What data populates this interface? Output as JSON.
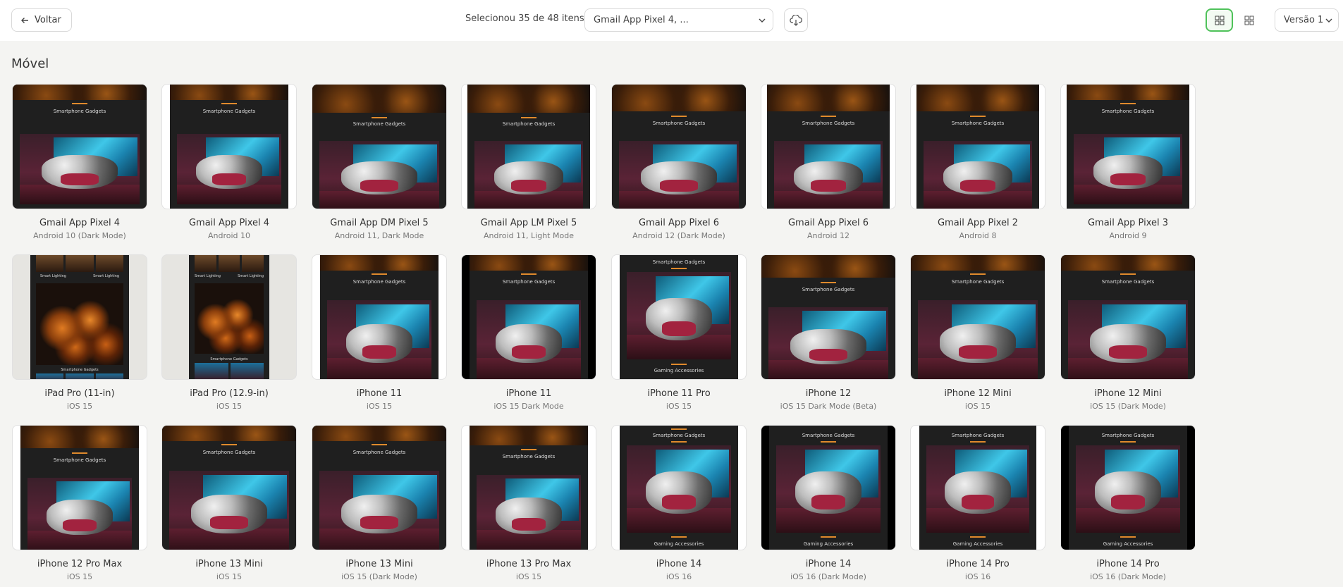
{
  "header": {
    "back_label": "Voltar",
    "selection_text": "Selecionou 35 de 48 itens",
    "device_select_value": "Gmail App Pixel 4, ...",
    "version_label": "Versão 1"
  },
  "colors": {
    "accent": "#4fc25a",
    "orange_accent": "#e08a2c",
    "screen_dark": "#1f1f1f"
  },
  "section": {
    "title": "Móvel"
  },
  "thumb_text": {
    "gadgets": "Smartphone Gadgets",
    "accessories": "Gaming Accessories",
    "lighting_a": "Smart Lighting",
    "lighting_b": "Smart Lighting"
  },
  "devices": [
    {
      "name": "Gmail App Pixel 4",
      "os": "Android 10 (Dark Mode)"
    },
    {
      "name": "Gmail App Pixel 4",
      "os": "Android 10"
    },
    {
      "name": "Gmail App DM Pixel 5",
      "os": "Android 11, Dark Mode"
    },
    {
      "name": "Gmail App LM Pixel 5",
      "os": "Android 11, Light Mode"
    },
    {
      "name": "Gmail App Pixel 6",
      "os": "Android 12 (Dark Mode)"
    },
    {
      "name": "Gmail App Pixel 6",
      "os": "Android 12"
    },
    {
      "name": "Gmail App Pixel 2",
      "os": "Android 8"
    },
    {
      "name": "Gmail App Pixel 3",
      "os": "Android 9"
    },
    {
      "name": "iPad Pro (11-in)",
      "os": "iOS 15"
    },
    {
      "name": "iPad Pro (12.9-in)",
      "os": "iOS 15"
    },
    {
      "name": "iPhone 11",
      "os": "iOS 15"
    },
    {
      "name": "iPhone 11",
      "os": "iOS 15 Dark Mode"
    },
    {
      "name": "iPhone 11 Pro",
      "os": "iOS 15"
    },
    {
      "name": "iPhone 12",
      "os": "iOS 15 Dark Mode (Beta)"
    },
    {
      "name": "iPhone 12 Mini",
      "os": "iOS 15"
    },
    {
      "name": "iPhone 12 Mini",
      "os": "iOS 15 (Dark Mode)"
    },
    {
      "name": "iPhone 12 Pro Max",
      "os": "iOS 15"
    },
    {
      "name": "iPhone 13 Mini",
      "os": "iOS 15"
    },
    {
      "name": "iPhone 13 Mini",
      "os": "iOS 15 (Dark Mode)"
    },
    {
      "name": "iPhone 13 Pro Max",
      "os": "iOS 15"
    },
    {
      "name": "iPhone 14",
      "os": "iOS 16"
    },
    {
      "name": "iPhone 14",
      "os": "iOS 16 (Dark Mode)"
    },
    {
      "name": "iPhone 14 Pro",
      "os": "iOS 16"
    },
    {
      "name": "iPhone 14 Pro",
      "os": "iOS 16 (Dark Mode)"
    }
  ]
}
